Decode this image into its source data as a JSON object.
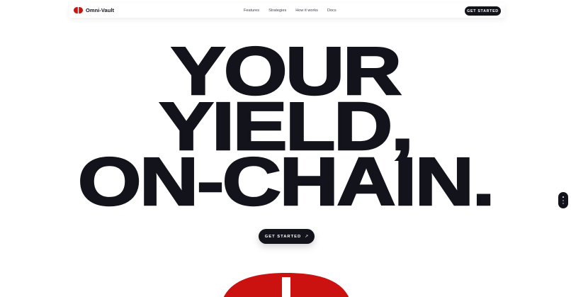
{
  "brand": {
    "name": "Omni-Vault",
    "logo_icon": "vault-logo-icon",
    "accent_color": "#cc1111"
  },
  "nav": {
    "links": [
      "Features",
      "Strategies",
      "How it works",
      "Docs"
    ],
    "cta_label": "GET STARTED"
  },
  "hero": {
    "title_lines": [
      "YOUR",
      "YIELD,",
      "ON-CHAIN."
    ],
    "cta_label": "GET STARTED",
    "cta_icon": "arrow-up-right-icon"
  },
  "section_nav": {
    "dot_count": 3,
    "active_index": 0
  },
  "colors": {
    "ink": "#13131c",
    "background": "#ffffff",
    "accent": "#cc1111"
  }
}
